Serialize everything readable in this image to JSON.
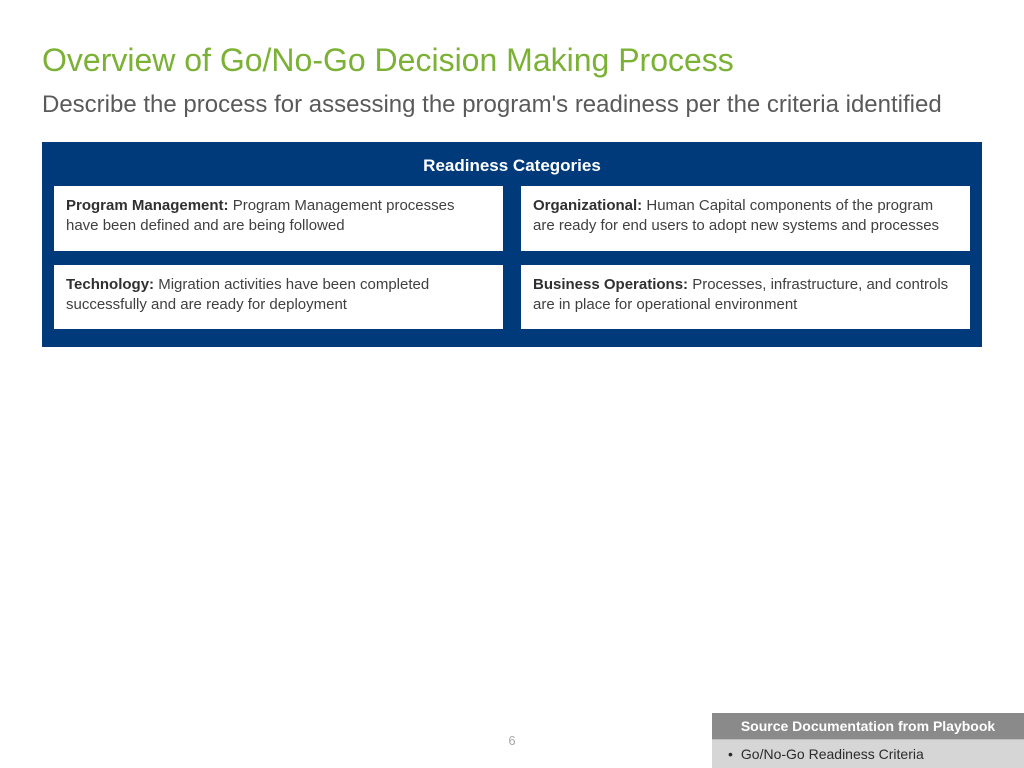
{
  "title": "Overview of Go/No-Go Decision Making Process",
  "subtitle": "Describe the process for assessing the program's readiness per the criteria identified",
  "panel": {
    "header": "Readiness Categories",
    "cards": [
      {
        "label": "Program Management:",
        "text": " Program Management processes have been defined and are being followed"
      },
      {
        "label": "Organizational:",
        "text": " Human Capital components of the program are ready for end users to adopt new systems and processes"
      },
      {
        "label": "Technology:",
        "text": " Migration activities have been completed successfully and are ready for deployment"
      },
      {
        "label": "Business Operations:",
        "text": " Processes, infrastructure, and controls are in place for operational environment"
      }
    ]
  },
  "pageNumber": "6",
  "sourceBox": {
    "header": "Source Documentation from Playbook",
    "item": "Go/No-Go Readiness Criteria"
  }
}
